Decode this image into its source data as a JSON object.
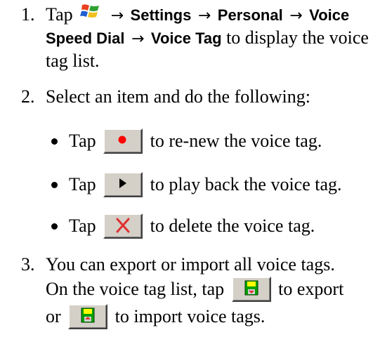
{
  "steps": [
    {
      "number": "1.",
      "line1_tap": "Tap",
      "start_icon": "windows-start-flag-icon",
      "arrow": "→",
      "menu_settings": "Settings",
      "menu_personal": "Personal",
      "menu_voice": "Voice",
      "menu_speed_dial": "Speed Dial",
      "menu_voice_tag": "Voice Tag",
      "line2_rest": "to display the voice",
      "line3": "tag list."
    },
    {
      "number": "2.",
      "text": "Select an item and do the following:",
      "bullets": [
        {
          "prefix": "Tap",
          "icon": "record-icon",
          "suffix": "to re-new the voice tag."
        },
        {
          "prefix": "Tap",
          "icon": "play-icon",
          "suffix": "to play back the voice tag."
        },
        {
          "prefix": "Tap",
          "icon": "delete-x-icon",
          "suffix": "to delete the voice tag."
        }
      ]
    },
    {
      "number": "3.",
      "line1": "You can export or import all voice tags.",
      "line2_prefix": "On the voice tag list, tap",
      "export_icon": "export-icon",
      "line2_suffix": "to export",
      "line3_prefix": "or",
      "import_icon": "import-icon",
      "line3_suffix": "to import voice tags."
    }
  ],
  "colors": {
    "button_face": "#d4d0c8",
    "record_red": "#ff0000",
    "delete_red": "#e03030",
    "disk_green": "#00a000",
    "disk_yellow": "#ffff00"
  }
}
